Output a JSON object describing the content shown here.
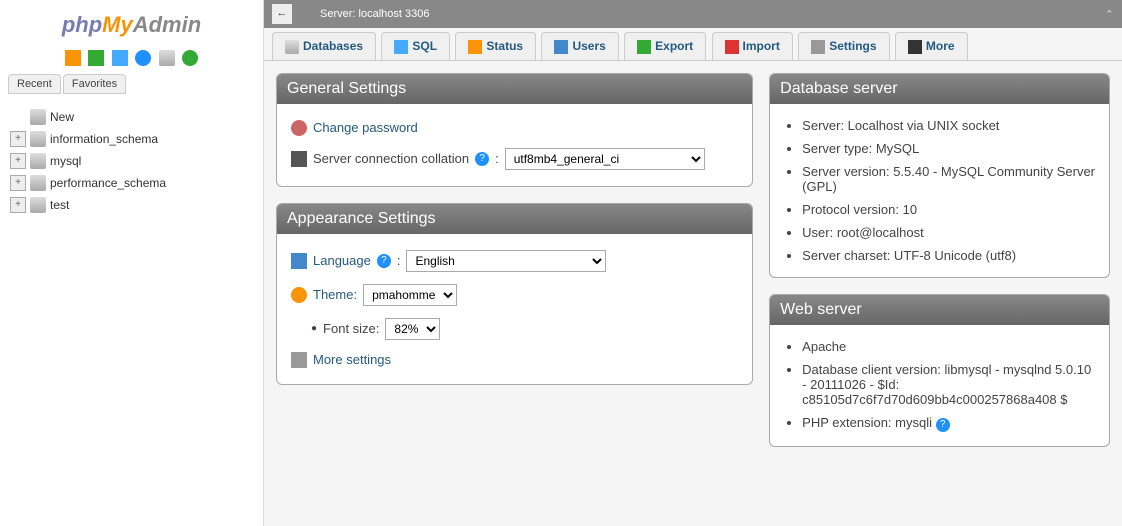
{
  "logo": {
    "php": "php",
    "my": "My",
    "admin": "Admin"
  },
  "sidebar_tabs": {
    "recent": "Recent",
    "favorites": "Favorites"
  },
  "tree": {
    "new": "New",
    "items": [
      "information_schema",
      "mysql",
      "performance_schema",
      "test"
    ]
  },
  "breadcrumb": "Server: localhost 3306",
  "main_tabs": {
    "databases": "Databases",
    "sql": "SQL",
    "status": "Status",
    "users": "Users",
    "export": "Export",
    "import": "Import",
    "settings": "Settings",
    "more": "More"
  },
  "panels": {
    "general": {
      "title": "General Settings",
      "change_password": "Change password",
      "collation_label": "Server connection collation",
      "collation_value": "utf8mb4_general_ci"
    },
    "appearance": {
      "title": "Appearance Settings",
      "language_label": "Language",
      "language_value": "English",
      "theme_label": "Theme:",
      "theme_value": "pmahomme",
      "fontsize_label": "Font size:",
      "fontsize_value": "82%",
      "more_settings": "More settings"
    },
    "dbserver": {
      "title": "Database server",
      "items": [
        "Server: Localhost via UNIX socket",
        "Server type: MySQL",
        "Server version: 5.5.40 - MySQL Community Server (GPL)",
        "Protocol version: 10",
        "User: root@localhost",
        "Server charset: UTF-8 Unicode (utf8)"
      ]
    },
    "webserver": {
      "title": "Web server",
      "items": [
        "Apache",
        "Database client version: libmysql - mysqlnd 5.0.10 - 20111026 - $Id: c85105d7c6f7d70d609bb4c000257868a408 $",
        "PHP extension: mysqli"
      ]
    }
  }
}
